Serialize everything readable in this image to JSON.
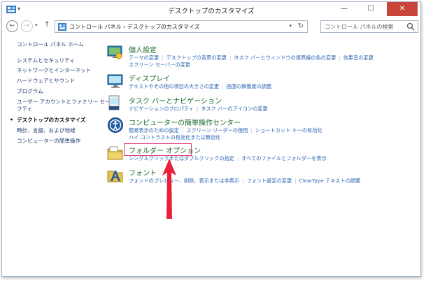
{
  "window": {
    "title": "デスクトップのカスタマイズ",
    "controls": {
      "minimize": "—",
      "maximize": "☐",
      "close": "✕"
    }
  },
  "nav": {
    "back_icon": "arrow-left-icon",
    "forward_icon": "arrow-right-icon",
    "recent_icon": "chevron-down-icon",
    "up_icon": "arrow-up-icon"
  },
  "address": {
    "path": "コントロール パネル › デスクトップのカスタマイズ",
    "refresh_icon": "refresh-icon"
  },
  "search": {
    "placeholder": "コントロール パネルの検索"
  },
  "sidebar": {
    "items": [
      {
        "label": "コントロール パネル ホーム"
      },
      {
        "label": "システムとセキュリティ"
      },
      {
        "label": "ネットワークとインターネット"
      },
      {
        "label": "ハードウェアとサウンド"
      },
      {
        "label": "プログラム"
      },
      {
        "label": "ユーザー アカウントとファミリー セー"
      },
      {
        "label": "フティ"
      },
      {
        "label": "デスクトップのカスタマイズ"
      },
      {
        "label": "時計、言語、および地域"
      },
      {
        "label": "コンピューターの簡単操作"
      }
    ]
  },
  "categories": [
    {
      "title": "個人設定",
      "icon": "personalization-icon",
      "links": [
        "テーマの変更",
        "デスクトップの背景の変更",
        "タスク バーとウィンドウの境界線の色の変更",
        "効果音の変更",
        "スクリーン セーバーの変更"
      ]
    },
    {
      "title": "ディスプレイ",
      "icon": "display-icon",
      "links": [
        "テキストやその他の項目の大きさの変更",
        "画面の解像度の調整"
      ]
    },
    {
      "title": "タスク バーとナビゲーション",
      "icon": "taskbar-icon",
      "links": [
        "ナビゲーションのプロパティ",
        "タスク バーのアイコンの変更"
      ]
    },
    {
      "title": "コンピューターの簡単操作センター",
      "icon": "ease-of-access-icon",
      "links": [
        "簡易表示のための設定",
        "スクリーン リーダーの使用",
        "ショートカット キーの有効化",
        "ハイ コントラストの有効化または無効化"
      ]
    },
    {
      "title": "フォルダー オプション",
      "icon": "folder-options-icon",
      "links": [
        "シングルクリックまたはダブルクリックの指定",
        "すべてのファイルとフォルダーを表示"
      ]
    },
    {
      "title": "フォント",
      "icon": "fonts-icon",
      "links": [
        "フォントのプレビュー、削除、表示または非表示",
        "フォント設定の変更",
        "ClearType テキストの調整"
      ]
    }
  ],
  "colors": {
    "category_title": "#1a6a28",
    "link": "#2a64b5",
    "highlight": "#e03c7a",
    "arrow": "#e8203a",
    "close_button": "#c8453a"
  }
}
